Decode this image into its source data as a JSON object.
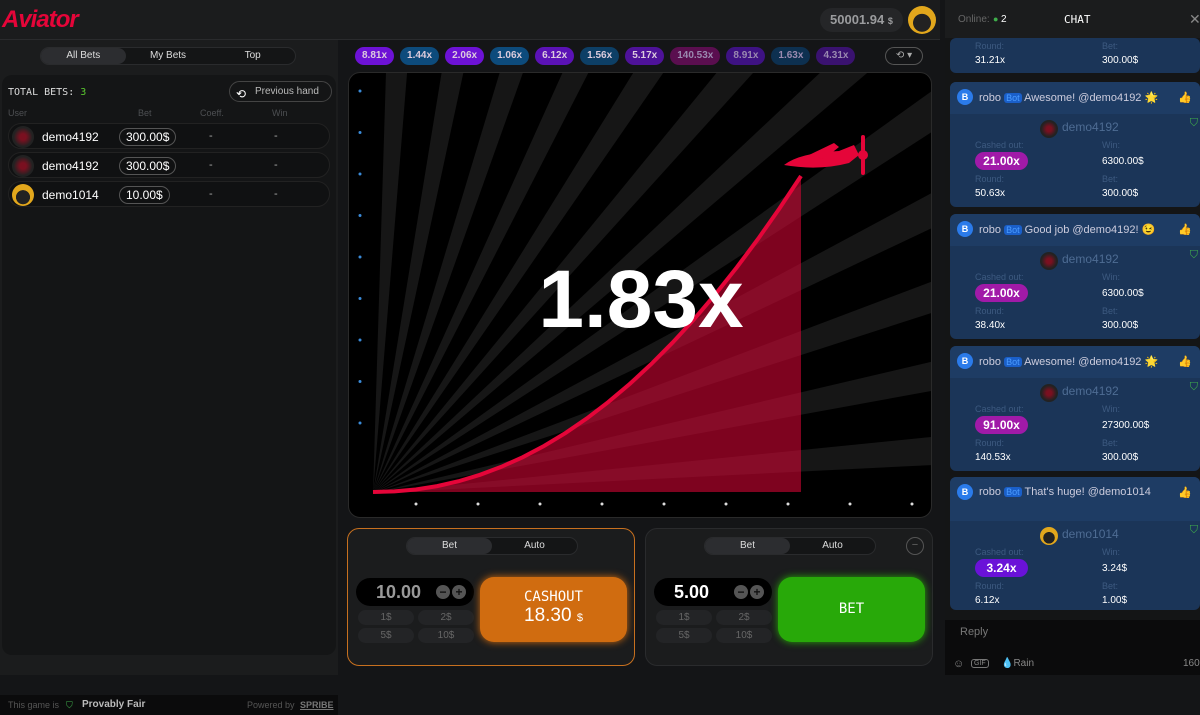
{
  "header": {
    "logo": "Aviator",
    "balance": "50001.94",
    "currency": "$"
  },
  "bets_tabs": [
    "All Bets",
    "My Bets",
    "Top"
  ],
  "bets": {
    "total_label": "TOTAL BETS:",
    "total": "3",
    "previous_hand": "Previous hand",
    "columns": [
      "User",
      "Bet",
      "Coeff.",
      "Win"
    ],
    "rows": [
      {
        "user": "demo4192",
        "bet": "300.00$",
        "coeff": "-",
        "win": "-"
      },
      {
        "user": "demo4192",
        "bet": "300.00$",
        "coeff": "-",
        "win": "-"
      },
      {
        "user": "demo1014",
        "bet": "10.00$",
        "coeff": "-",
        "win": "-"
      }
    ]
  },
  "footer": {
    "fair_prefix": "This game is",
    "fair": "Provably Fair",
    "powered": "Powered by",
    "brand": "SPRIBE"
  },
  "history": [
    {
      "v": "8.81x",
      "c": "#6d12d6"
    },
    {
      "v": "1.44x",
      "c": "#0d4b7c"
    },
    {
      "v": "2.06x",
      "c": "#6d12d6"
    },
    {
      "v": "1.06x",
      "c": "#0d4b7c"
    },
    {
      "v": "6.12x",
      "c": "#5b12b6"
    },
    {
      "v": "1.56x",
      "c": "#0d3f66"
    },
    {
      "v": "5.17x",
      "c": "#4e1299"
    },
    {
      "v": "140.53x",
      "c": "#5a0e4f"
    },
    {
      "v": "8.91x",
      "c": "#3e1283"
    },
    {
      "v": "1.63x",
      "c": "#0d3050"
    },
    {
      "v": "4.31x",
      "c": "#3a1270"
    }
  ],
  "game": {
    "multiplier": "1.83x",
    "accent": "#e50539"
  },
  "panels": [
    {
      "tabs": [
        "Bet",
        "Auto"
      ],
      "amount": "10.00",
      "quick": [
        "1$",
        "2$",
        "5$",
        "10$"
      ],
      "button": "CASHOUT",
      "button_amount": "18.30",
      "currency": "$",
      "color": "#d06c10"
    },
    {
      "tabs": [
        "Bet",
        "Auto"
      ],
      "amount": "5.00",
      "quick": [
        "1$",
        "2$",
        "5$",
        "10$"
      ],
      "button": "BET",
      "color": "#28a909"
    }
  ],
  "chat": {
    "online_label": "Online:",
    "online": "2",
    "title": "CHAT",
    "reply_placeholder": "Reply",
    "gif": "GIF",
    "rain": "Rain",
    "count": "160",
    "partial": {
      "round_label": "Round:",
      "round": "31.21x",
      "bet_label": "Bet:",
      "bet": "300.00$"
    },
    "messages": [
      {
        "user": "robo",
        "badge": "Bot",
        "text": "Awesome! @demo4192 🌟",
        "winner": "demo4192",
        "cashed_label": "Cashed out:",
        "cashed": "21.00x",
        "win_label": "Win:",
        "win": "6300.00$",
        "round_label": "Round:",
        "round": "50.63x",
        "bet_label": "Bet:",
        "bet": "300.00$",
        "pill": "#a01aa8"
      },
      {
        "user": "robo",
        "badge": "Bot",
        "text": "Good job @demo4192! 😉",
        "winner": "demo4192",
        "cashed_label": "Cashed out:",
        "cashed": "21.00x",
        "win_label": "Win:",
        "win": "6300.00$",
        "round_label": "Round:",
        "round": "38.40x",
        "bet_label": "Bet:",
        "bet": "300.00$",
        "pill": "#a01aa8"
      },
      {
        "user": "robo",
        "badge": "Bot",
        "text": "Awesome! @demo4192 🌟",
        "winner": "demo4192",
        "cashed_label": "Cashed out:",
        "cashed": "91.00x",
        "win_label": "Win:",
        "win": "27300.00$",
        "round_label": "Round:",
        "round": "140.53x",
        "bet_label": "Bet:",
        "bet": "300.00$",
        "pill": "#a01aa8"
      },
      {
        "user": "robo",
        "badge": "Bot",
        "text": "That's huge! @demo1014",
        "winner": "demo1014",
        "cashed_label": "Cashed out:",
        "cashed": "3.24x",
        "win_label": "Win:",
        "win": "3.24$",
        "round_label": "Round:",
        "round": "6.12x",
        "bet_label": "Bet:",
        "bet": "1.00$",
        "pill": "#6a12d8"
      }
    ]
  }
}
